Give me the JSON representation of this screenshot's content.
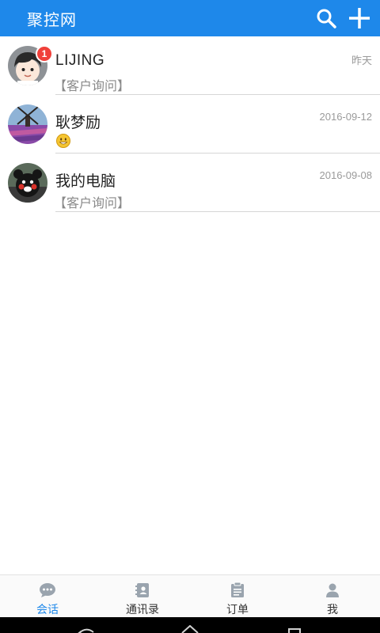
{
  "header": {
    "title": "聚控网",
    "search_icon": "search-icon",
    "add_icon": "plus-icon",
    "color": "#1e88ea"
  },
  "conversations": [
    {
      "name": "LIJING",
      "time": "昨天",
      "preview": "【客户询问】",
      "badge": "1",
      "avatar": "cartoon-boy-avatar"
    },
    {
      "name": "耿梦励",
      "time": "2016-09-12",
      "preview_icon": "smiley-emoji-icon",
      "avatar": "windmill-tulip-field-avatar"
    },
    {
      "name": "我的电脑",
      "time": "2016-09-08",
      "preview": "【客户询问】",
      "avatar": "kumamon-bear-avatar"
    }
  ],
  "tabs": [
    {
      "label": "会话",
      "icon": "chat-bubble-icon",
      "active": true
    },
    {
      "label": "通讯录",
      "icon": "contacts-book-icon",
      "active": false
    },
    {
      "label": "订单",
      "icon": "clipboard-icon",
      "active": false
    },
    {
      "label": "我",
      "icon": "person-icon",
      "active": false
    }
  ],
  "active_color": "#1e88ea"
}
